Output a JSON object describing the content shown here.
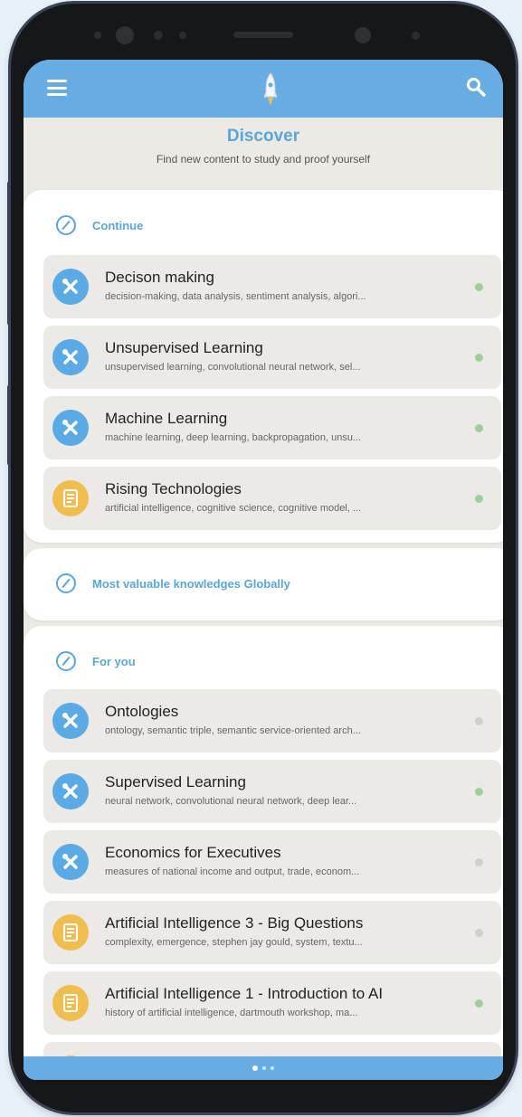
{
  "header": {
    "menu_icon": "hamburger-menu-icon",
    "logo_icon": "rocket-icon",
    "search_icon": "search-icon"
  },
  "discover": {
    "title": "Discover",
    "subtitle": "Find new content to study and proof yourself"
  },
  "sections": {
    "continue": {
      "title": "Continue",
      "items": [
        {
          "title": "Decison making",
          "subtitle": "decision-making, data analysis, sentiment analysis, algori...",
          "icon": "tools-icon",
          "icon_color": "#5aaae6",
          "status": "green"
        },
        {
          "title": "Unsupervised Learning",
          "subtitle": "unsupervised learning, convolutional neural network, sel...",
          "icon": "tools-icon",
          "icon_color": "#5aaae6",
          "status": "green"
        },
        {
          "title": "Machine Learning",
          "subtitle": "machine learning, deep learning, backpropagation, unsu...",
          "icon": "tools-icon",
          "icon_color": "#5aaae6",
          "status": "green"
        },
        {
          "title": "Rising Technologies",
          "subtitle": "artificial intelligence, cognitive science, cognitive model, ...",
          "icon": "document-icon",
          "icon_color": "#f0be4e",
          "status": "green"
        }
      ]
    },
    "most_valuable": {
      "title": "Most valuable knowledges Globally"
    },
    "for_you": {
      "title": "For you",
      "items": [
        {
          "title": "Ontologies",
          "subtitle": "ontology, semantic triple, semantic service-oriented arch...",
          "icon": "tools-icon",
          "icon_color": "#5aaae6",
          "status": "gray"
        },
        {
          "title": "Supervised Learning",
          "subtitle": "neural network, convolutional neural network, deep lear...",
          "icon": "tools-icon",
          "icon_color": "#5aaae6",
          "status": "green"
        },
        {
          "title": "Economics for Executives",
          "subtitle": "measures of national income and output, trade, econom...",
          "icon": "tools-icon",
          "icon_color": "#5aaae6",
          "status": "gray"
        },
        {
          "title": "Artificial Intelligence 3 - Big Questions",
          "subtitle": "complexity, emergence, stephen jay gould, system, textu...",
          "icon": "document-icon",
          "icon_color": "#f0be4e",
          "status": "gray"
        },
        {
          "title": "Artificial Intelligence 1 - Introduction to AI",
          "subtitle": "history of artificial intelligence, dartmouth workshop, ma...",
          "icon": "document-icon",
          "icon_color": "#f0be4e",
          "status": "green"
        }
      ]
    }
  },
  "pager": {
    "pages": 3,
    "current": 1
  },
  "colors": {
    "accent": "#67ade3",
    "title_blue": "#5aa6dc",
    "status_green": "#9fcf96",
    "status_gray": "#cfcfcf"
  }
}
